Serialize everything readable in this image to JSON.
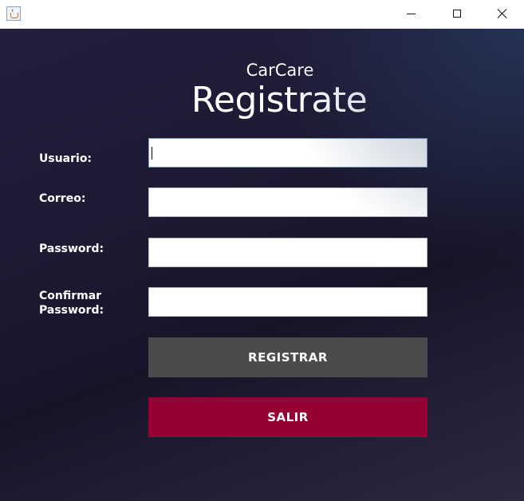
{
  "window": {
    "icon": "java-cup-icon",
    "controls": {
      "minimize": "minimize-icon",
      "maximize": "maximize-icon",
      "close": "close-icon"
    }
  },
  "header": {
    "subtitle": "CarCare",
    "title": "Registrate"
  },
  "form": {
    "usuario_label": "Usuario:",
    "usuario_value": "",
    "correo_label": "Correo:",
    "correo_value": "",
    "password_label": "Password:",
    "password_value": "",
    "confirm_label_line1": "Confirmar",
    "confirm_label_line2": "Password:",
    "confirm_value": ""
  },
  "actions": {
    "registrar_label": "REGISTRAR",
    "salir_label": "SALIR"
  },
  "colors": {
    "background": "#1d1a33",
    "registrar_button": "#4b4b4d",
    "salir_button": "#960034",
    "text": "#ffffff"
  }
}
